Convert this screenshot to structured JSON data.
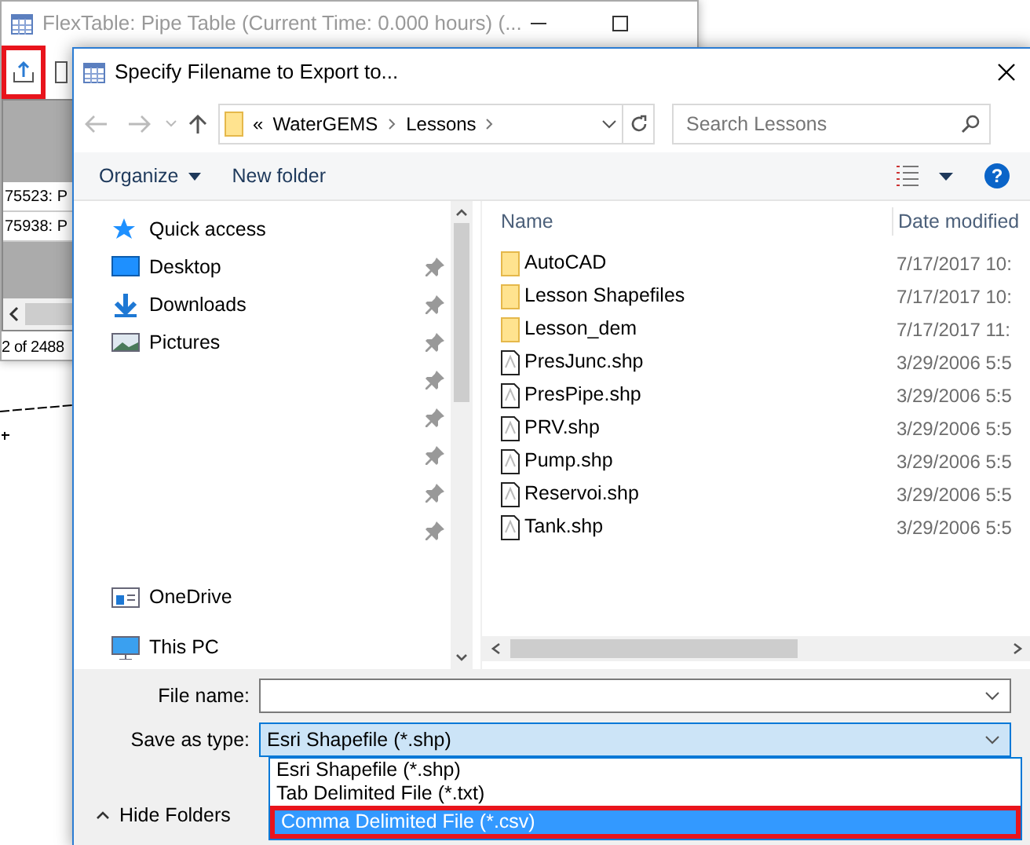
{
  "background_window": {
    "title": "FlexTable: Pipe Table (Current Time:  0.000 hours) (...",
    "export_highlighted": true,
    "rows": [
      "75523: P",
      "75938: P"
    ],
    "status": "2 of 2488"
  },
  "dialog": {
    "title": "Specify Filename to Export to...",
    "breadcrumb": {
      "overflow": "«",
      "parts": [
        "WaterGEMS",
        "Lessons"
      ]
    },
    "search": {
      "placeholder": "Search Lessons"
    },
    "help": "?",
    "toolbar": [
      {
        "label": "Organize",
        "menu": true
      },
      {
        "label": "New folder",
        "menu": false
      }
    ],
    "nav": [
      {
        "label": "Quick access",
        "kind": "quick",
        "pinned": false
      },
      {
        "label": "Desktop",
        "kind": "desktop",
        "pinned": true
      },
      {
        "label": "Downloads",
        "kind": "downloads",
        "pinned": true
      },
      {
        "label": "Pictures",
        "kind": "pictures",
        "pinned": true
      },
      {
        "kind": "blank",
        "pinned": true
      },
      {
        "kind": "blank",
        "pinned": true
      },
      {
        "kind": "blank",
        "pinned": true
      },
      {
        "kind": "blank",
        "pinned": true
      },
      {
        "kind": "blank",
        "pinned": true
      },
      {
        "label": "OneDrive",
        "kind": "onedrive",
        "pinned": false
      },
      {
        "label": "This PC",
        "kind": "pc",
        "pinned": false
      }
    ],
    "columns": [
      "Name",
      "Date modified"
    ],
    "files": [
      {
        "name": "AutoCAD",
        "kind": "folder",
        "date": "7/17/2017 10:"
      },
      {
        "name": "Lesson Shapefiles",
        "kind": "folder",
        "date": "7/17/2017 10:"
      },
      {
        "name": "Lesson_dem",
        "kind": "folder",
        "date": "7/17/2017 11:"
      },
      {
        "name": "PresJunc.shp",
        "kind": "file",
        "date": "3/29/2006 5:5"
      },
      {
        "name": "PresPipe.shp",
        "kind": "file",
        "date": "3/29/2006 5:5"
      },
      {
        "name": "PRV.shp",
        "kind": "file",
        "date": "3/29/2006 5:5"
      },
      {
        "name": "Pump.shp",
        "kind": "file",
        "date": "3/29/2006 5:5"
      },
      {
        "name": "Reservoi.shp",
        "kind": "file",
        "date": "3/29/2006 5:5"
      },
      {
        "name": "Tank.shp",
        "kind": "file",
        "date": "3/29/2006 5:5"
      }
    ],
    "file_name": {
      "label": "File name:"
    },
    "save_type": {
      "label": "Save as type:",
      "value": "Esri Shapefile (*.shp)",
      "expanded": true
    },
    "options": [
      {
        "label": "Esri Shapefile (*.shp)",
        "selected": false,
        "highlighted": false
      },
      {
        "label": "Tab Delimited File (*.txt)",
        "selected": false,
        "highlighted": false
      },
      {
        "label": "Comma Delimited File (*.csv)",
        "selected": true,
        "highlighted": true
      }
    ],
    "hide_folders": {
      "label": "Hide Folders"
    }
  }
}
